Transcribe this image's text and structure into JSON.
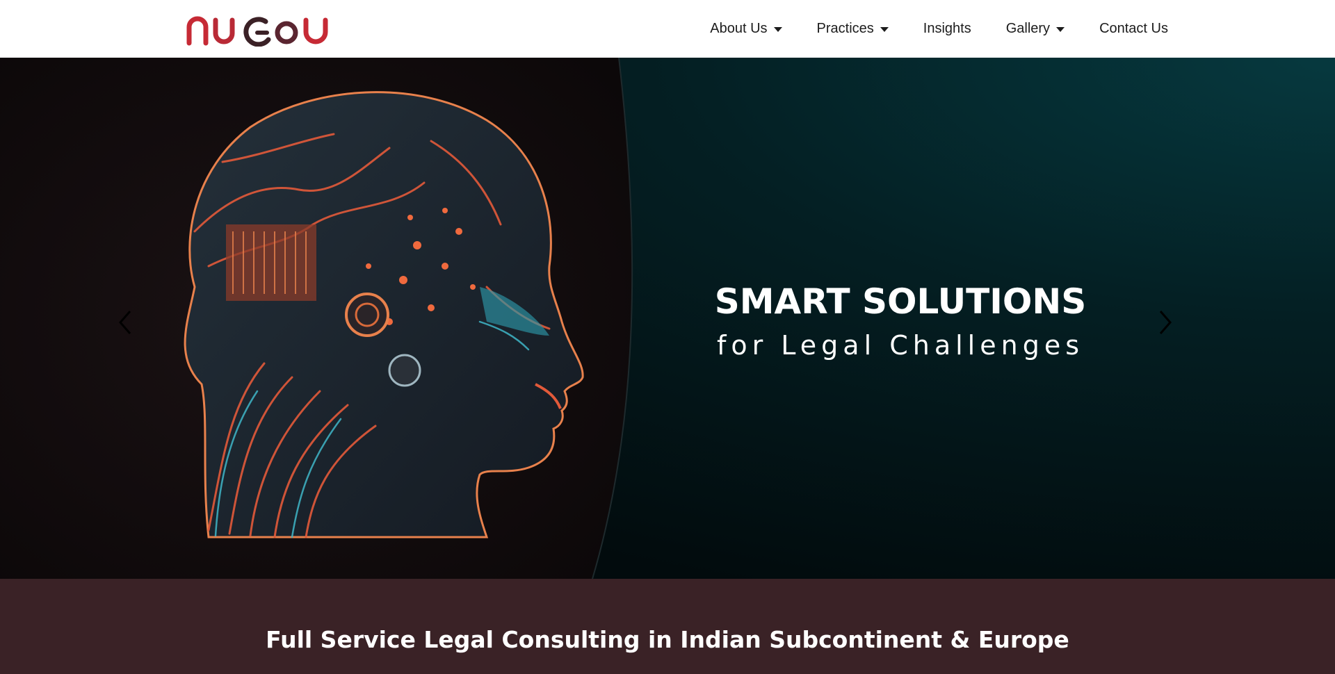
{
  "brand": {
    "logo_text": "nuGov",
    "logo_colors": {
      "primary": "#c62a35",
      "secondary": "#3b2126"
    }
  },
  "nav": {
    "items": [
      {
        "label": "About Us",
        "has_dropdown": true
      },
      {
        "label": "Practices",
        "has_dropdown": true
      },
      {
        "label": "Insights",
        "has_dropdown": false
      },
      {
        "label": "Gallery",
        "has_dropdown": true
      },
      {
        "label": "Contact Us",
        "has_dropdown": false
      }
    ]
  },
  "hero": {
    "title": "SMART SOLUTIONS",
    "subtitle": "for Legal Challenges",
    "image_icon": "circuit-brain-head-illustration",
    "prev_icon": "chevron-left-icon",
    "next_icon": "chevron-right-icon",
    "colors": {
      "left_bg": "#120c0e",
      "right_bg": "#04262a",
      "accent": "#e35a3a",
      "text": "#ffffff"
    }
  },
  "band": {
    "title": "Full Service Legal Consulting in Indian Subcontinent & Europe",
    "color": "#3a2226"
  }
}
